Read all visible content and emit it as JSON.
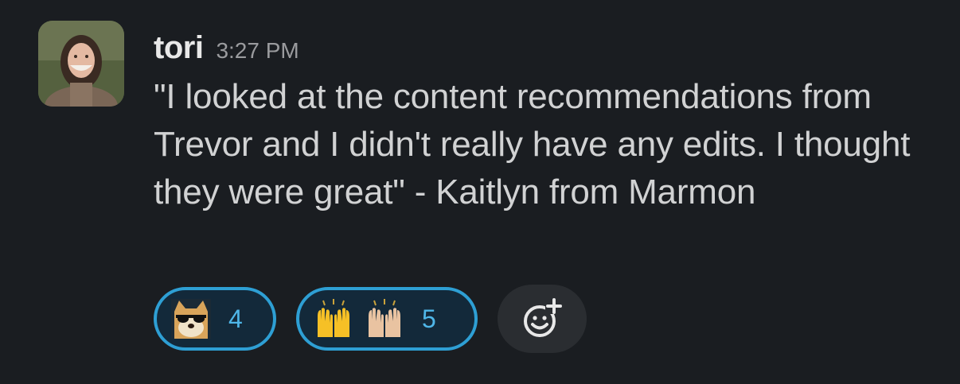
{
  "message": {
    "author": "tori",
    "timestamp": "3:27 PM",
    "text": "\"I looked at the content recommendations from Trevor and I didn't really have any edits. I thought they were great\" - Kaitlyn from Marmon"
  },
  "reactions": [
    {
      "emoji": "doge-sunglasses-icon",
      "count": "4"
    },
    {
      "emoji": "raised-hands-icon",
      "count": "5"
    }
  ],
  "colors": {
    "background": "#1a1d21",
    "reaction_border": "#2e9fd4",
    "reaction_count": "#4fb6e8"
  }
}
